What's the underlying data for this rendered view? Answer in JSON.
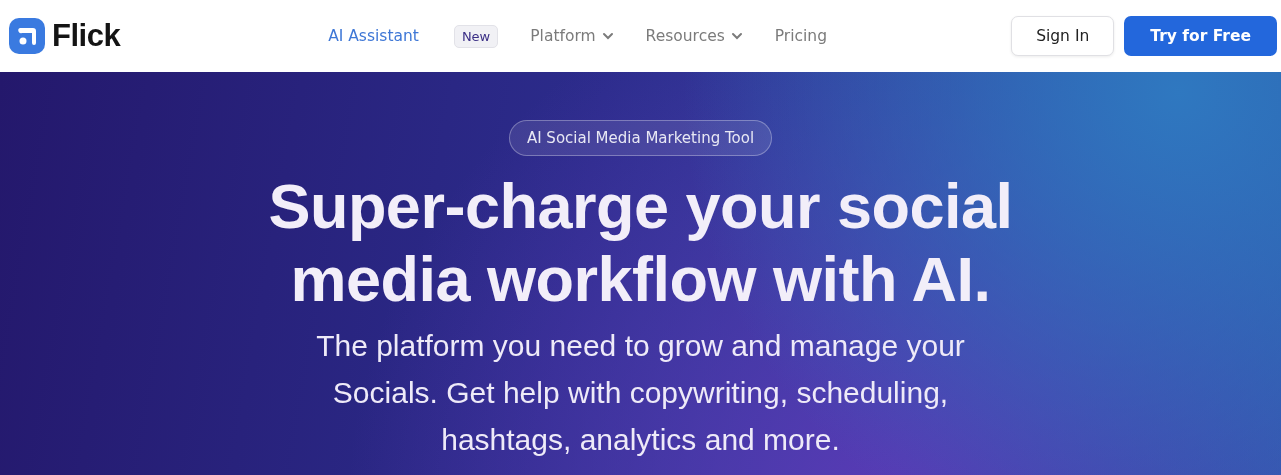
{
  "logo": {
    "text": "Flick"
  },
  "nav": [
    {
      "label": "AI Assistant",
      "selected": true,
      "dropdown": false,
      "badge": "New"
    },
    {
      "label": "Platform",
      "selected": false,
      "dropdown": true
    },
    {
      "label": "Resources",
      "selected": false,
      "dropdown": true
    },
    {
      "label": "Pricing",
      "selected": false,
      "dropdown": false
    }
  ],
  "buttons": [
    {
      "label": "Sign In",
      "kind": "secondary"
    },
    {
      "label": "Try for Free",
      "kind": "primary"
    }
  ],
  "hero": {
    "badge": "AI Social Media Marketing Tool",
    "headline": "Super-charge your social media workflow with AI.",
    "subtitle": "The platform you need to grow and manage your Socials. Get help with copywriting, scheduling, hashtags, analytics and more."
  }
}
